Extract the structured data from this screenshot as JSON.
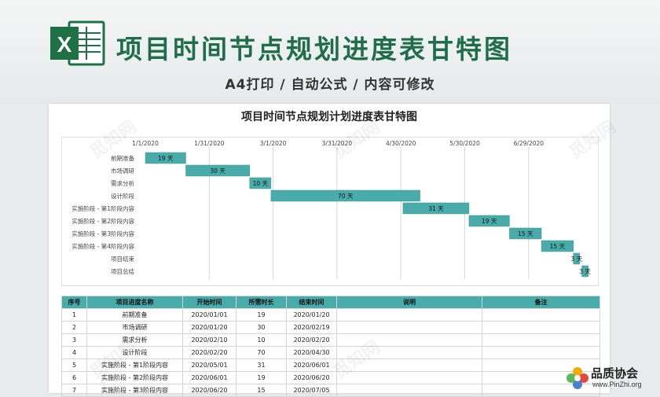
{
  "banner": {
    "title": "项目时间节点规划进度表甘特图",
    "subtitle": "A4打印 / 自动公式 / 内容可修改",
    "logo_letter": "X"
  },
  "colors": {
    "accent": "#4aacaa",
    "title_green": "#1f6d4a",
    "bar": "#4aacaa"
  },
  "chart_data": {
    "type": "bar",
    "orientation": "horizontal-gantt",
    "title": "项目时间节点规划计划进度表甘特图",
    "date_ticks": [
      "1/1/2020",
      "1/31/2020",
      "3/1/2020",
      "3/31/2020",
      "4/30/2020",
      "5/30/2020",
      "6/29/2020"
    ],
    "x_start": "2020-01-01",
    "grid": true,
    "categories": [
      "前期准备",
      "市场调研",
      "需求分析",
      "设计阶段",
      "实施阶段 - 第1阶段内容",
      "实施阶段 - 第2阶段内容",
      "实施阶段 - 第3阶段内容",
      "实施阶段 - 第4阶段内容",
      "项目结束",
      "项目总结"
    ],
    "start_dates": [
      "2020-01-01",
      "2020-01-20",
      "2020-02-19",
      "2020-02-29",
      "2020-05-01",
      "2020-06-01",
      "2020-06-20",
      "2020-07-05",
      "2020-07-20",
      "2020-07-24"
    ],
    "durations": [
      19,
      30,
      10,
      70,
      31,
      19,
      15,
      15,
      3,
      3
    ],
    "bar_labels": [
      "19 天",
      "30 天",
      "10 天",
      "70 天",
      "31 天",
      "19 天",
      "15 天",
      "15 天",
      "3 天",
      "3 天"
    ]
  },
  "table": {
    "headers": [
      "序号",
      "项目进度名称",
      "开始时间",
      "所需时长",
      "结束时间",
      "说明",
      "备注"
    ],
    "rows": [
      [
        "1",
        "前期准备",
        "2020/01/01",
        "19",
        "2020/01/20",
        "",
        ""
      ],
      [
        "2",
        "市场调研",
        "2020/01/20",
        "30",
        "2020/02/19",
        "",
        ""
      ],
      [
        "3",
        "需求分析",
        "2020/02/10",
        "10",
        "2020/02/20",
        "",
        ""
      ],
      [
        "4",
        "设计阶段",
        "2020/02/20",
        "70",
        "2020/04/30",
        "",
        ""
      ],
      [
        "5",
        "实施阶段 - 第1阶段内容",
        "2020/05/01",
        "31",
        "2020/06/01",
        "",
        ""
      ],
      [
        "6",
        "实施阶段 - 第2阶段内容",
        "2020/06/01",
        "19",
        "2020/06/20",
        "",
        ""
      ],
      [
        "7",
        "实施阶段 - 第3阶段内容",
        "2020/06/20",
        "15",
        "2020/07/05",
        "",
        ""
      ]
    ]
  },
  "brand": {
    "name": "品质协会",
    "url": "www.PinZhi.org"
  },
  "watermark": "觅知网"
}
